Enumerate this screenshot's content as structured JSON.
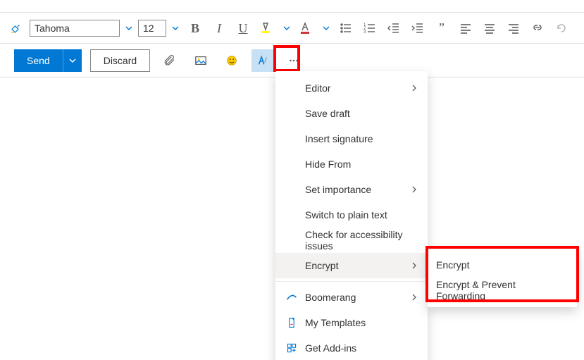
{
  "toolbar": {
    "font_name": "Tahoma",
    "font_size": "12"
  },
  "actions": {
    "send_label": "Send",
    "discard_label": "Discard"
  },
  "menu": {
    "editor": "Editor",
    "save_draft": "Save draft",
    "insert_signature": "Insert signature",
    "hide_from": "Hide From",
    "set_importance": "Set importance",
    "switch_plain": "Switch to plain text",
    "accessibility": "Check for accessibility issues",
    "encrypt": "Encrypt",
    "boomerang": "Boomerang",
    "my_templates": "My Templates",
    "get_addins": "Get Add-ins"
  },
  "submenu": {
    "encrypt": "Encrypt",
    "encrypt_prevent": "Encrypt & Prevent Forwarding"
  }
}
